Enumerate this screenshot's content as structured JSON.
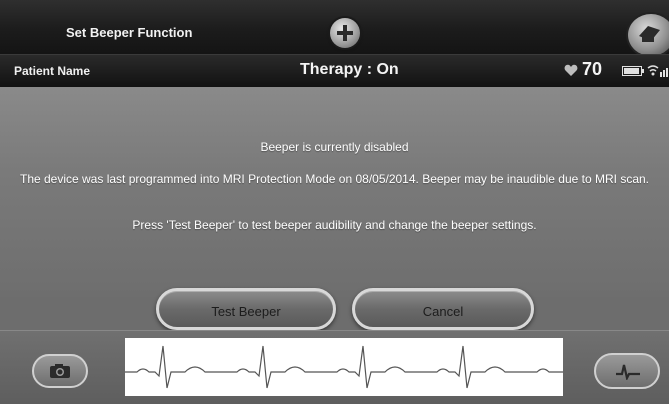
{
  "header": {
    "title": "Set Beeper Function",
    "icons": [
      "plus-icon",
      "printer-icon"
    ]
  },
  "status": {
    "patient_label": "Patient Name",
    "therapy": "Therapy : On",
    "heart_rate": "70",
    "icons": [
      "heart-icon",
      "battery-icon",
      "signal-icon"
    ]
  },
  "message": {
    "line1": "Beeper is currently disabled",
    "line2": "The device was last programmed into MRI Protection Mode on 08/05/2014. Beeper may be inaudible due to MRI scan.",
    "line3": "Press 'Test Beeper' to test beeper audibility and change the beeper settings."
  },
  "buttons": {
    "test": "Test Beeper",
    "cancel": "Cancel"
  },
  "footer": {
    "icons": [
      "camera-icon",
      "ecg-strip",
      "waveform-icon"
    ]
  },
  "colors": {
    "titlebar": "#1c1c1c",
    "content_bg": "#7a7a7a",
    "text": "#ffffff"
  }
}
